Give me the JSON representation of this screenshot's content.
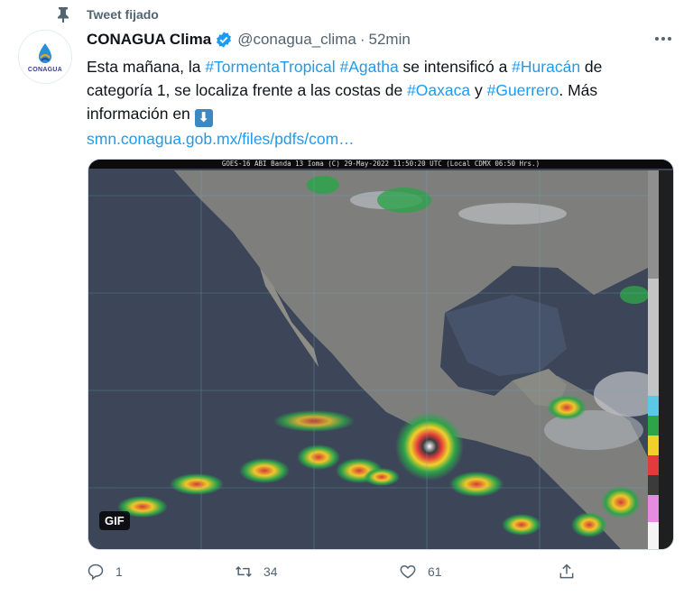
{
  "pinned": {
    "label": "Tweet fijado"
  },
  "author": {
    "name": "CONAGUA Clima",
    "handle": "@conagua_clima",
    "separator": "·",
    "time": "52min",
    "avatar_text": "CONAGUA"
  },
  "tweet": {
    "segments": [
      {
        "text": "Esta mañana, la ",
        "type": "text"
      },
      {
        "text": "#TormentaTropical",
        "type": "hashtag"
      },
      {
        "text": " ",
        "type": "text"
      },
      {
        "text": "#Agatha",
        "type": "hashtag"
      },
      {
        "text": " se intensificó a ",
        "type": "text"
      },
      {
        "text": "#Huracán",
        "type": "hashtag"
      },
      {
        "text": " de categoría 1, se localiza frente a las costas de ",
        "type": "text"
      },
      {
        "text": "#Oaxaca",
        "type": "hashtag"
      },
      {
        "text": " y ",
        "type": "text"
      },
      {
        "text": "#Guerrero",
        "type": "hashtag"
      },
      {
        "text": ". Más información en ",
        "type": "text"
      }
    ],
    "emoji": "⬇",
    "link": "smn.conagua.gob.mx/files/pdfs/com…"
  },
  "media": {
    "badge": "GIF",
    "header_text": "GOES-16 ABI Banda 13 Ioma (C) 29-May-2022 11:50:20 UTC (Local CDMX  06:50 Hrs.)",
    "colors": {
      "ocean": "#3c4658",
      "land": "#8a8a84",
      "storm": "#d43a3a"
    }
  },
  "actions": {
    "reply_count": "1",
    "retweet_count": "34",
    "like_count": "61"
  },
  "colors": {
    "accent": "#1d9bf0",
    "muted": "#536471"
  }
}
